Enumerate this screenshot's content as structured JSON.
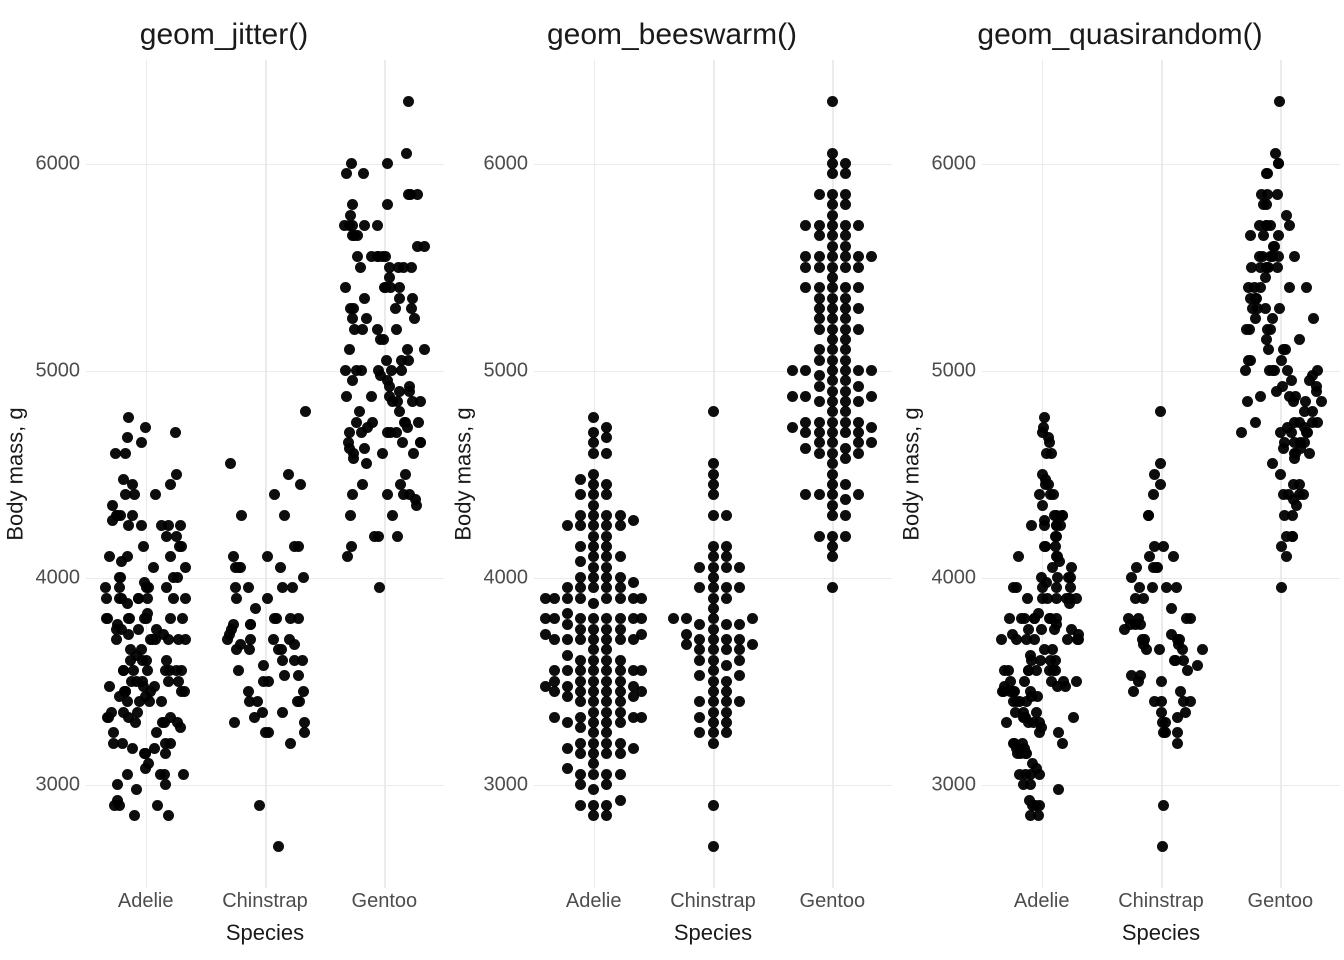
{
  "chart_data": [
    {
      "type": "scatter",
      "title": "geom_jitter()",
      "xlabel": "Species",
      "ylabel": "Body mass, g",
      "categories": [
        "Adelie",
        "Chinstrap",
        "Gentoo"
      ],
      "ylim": [
        2500,
        6500
      ],
      "yticks": [
        3000,
        4000,
        5000,
        6000
      ],
      "layout": "jitter",
      "range_estimates": {
        "Adelie": [
          2850,
          4775
        ],
        "Chinstrap": [
          2700,
          4800
        ],
        "Gentoo": [
          3950,
          6300
        ]
      }
    },
    {
      "type": "scatter",
      "title": "geom_beeswarm()",
      "xlabel": "Species",
      "ylabel": "Body mass, g",
      "categories": [
        "Adelie",
        "Chinstrap",
        "Gentoo"
      ],
      "ylim": [
        2500,
        6500
      ],
      "yticks": [
        3000,
        4000,
        5000,
        6000
      ],
      "layout": "beeswarm",
      "range_estimates": {
        "Adelie": [
          2850,
          4775
        ],
        "Chinstrap": [
          2700,
          4800
        ],
        "Gentoo": [
          3950,
          6300
        ]
      }
    },
    {
      "type": "scatter",
      "title": "geom_quasirandom()",
      "xlabel": "Species",
      "ylabel": "Body mass, g",
      "categories": [
        "Adelie",
        "Chinstrap",
        "Gentoo"
      ],
      "ylim": [
        2500,
        6500
      ],
      "yticks": [
        3000,
        4000,
        5000,
        6000
      ],
      "layout": "quasirandom",
      "range_estimates": {
        "Adelie": [
          2850,
          4775
        ],
        "Chinstrap": [
          2700,
          4800
        ],
        "Gentoo": [
          3950,
          6300
        ]
      }
    }
  ],
  "penguin_body_mass": {
    "Adelie": [
      3750,
      3800,
      3250,
      3450,
      3650,
      3625,
      4675,
      3475,
      4250,
      3300,
      3700,
      3200,
      3800,
      4400,
      3700,
      3450,
      4500,
      3325,
      4200,
      3400,
      3600,
      3800,
      3950,
      3800,
      3800,
      3550,
      3200,
      3150,
      3950,
      3250,
      3900,
      3300,
      3900,
      3325,
      4150,
      3950,
      3550,
      3300,
      4650,
      3150,
      3900,
      3100,
      4400,
      3000,
      4600,
      3425,
      2975,
      3450,
      4150,
      3500,
      4300,
      3450,
      4050,
      2900,
      3700,
      3550,
      3800,
      2850,
      3750,
      3150,
      4400,
      3600,
      4050,
      2850,
      3950,
      3350,
      4100,
      3050,
      4450,
      3600,
      3900,
      3550,
      4150,
      3700,
      4250,
      3700,
      3900,
      3550,
      4000,
      3200,
      4700,
      3800,
      4200,
      3350,
      3550,
      3800,
      3500,
      3950,
      3600,
      3550,
      4300,
      3400,
      4450,
      3300,
      4300,
      3700,
      4350,
      2900,
      4100,
      3725,
      4725,
      3075,
      4250,
      2925,
      3550,
      3750,
      3900,
      3175,
      4775,
      3825,
      4600,
      3200,
      4275,
      3900,
      4075,
      2900,
      3775,
      3350,
      3325,
      3150,
      3500,
      3450,
      3875,
      3050,
      4000,
      3275,
      4300,
      3050,
      4000,
      3325,
      3500,
      3500,
      4475,
      3425,
      3900,
      3175,
      3975,
      3400,
      4250,
      3400,
      3475,
      3050,
      3725,
      3000,
      3650,
      4250,
      3475,
      3450,
      3750,
      3700,
      4000,
      4100
    ],
    "Chinstrap": [
      3500,
      3900,
      3650,
      3525,
      3725,
      3950,
      3250,
      3750,
      4150,
      3700,
      3800,
      3775,
      3700,
      4050,
      3575,
      4050,
      3300,
      3700,
      3450,
      4400,
      3600,
      3400,
      2900,
      3800,
      3300,
      4150,
      3400,
      3800,
      3700,
      4550,
      3200,
      4300,
      3350,
      4100,
      3600,
      3900,
      3850,
      4800,
      2700,
      4500,
      3950,
      3650,
      3550,
      3500,
      3675,
      4450,
      3400,
      4300,
      3250,
      3675,
      3325,
      3950,
      3600,
      4050,
      3350,
      3450,
      3250,
      4050,
      3800,
      3525,
      3950,
      3650,
      3650,
      4000,
      3400,
      3775,
      4100,
      3775
    ],
    "Gentoo": [
      4500,
      5700,
      4450,
      5700,
      5400,
      4550,
      4800,
      5200,
      4400,
      5150,
      4650,
      5550,
      4650,
      5850,
      4200,
      5850,
      4150,
      6300,
      4800,
      5350,
      5700,
      5000,
      4400,
      5050,
      5000,
      5100,
      4100,
      5650,
      4600,
      5550,
      5250,
      4700,
      5050,
      6050,
      5150,
      5400,
      4950,
      5250,
      4350,
      5350,
      3950,
      5700,
      4300,
      4750,
      5550,
      4900,
      4200,
      5400,
      5100,
      5300,
      4850,
      5300,
      4400,
      5000,
      4900,
      5050,
      4300,
      5000,
      4450,
      5550,
      4200,
      5300,
      4400,
      5650,
      4700,
      5700,
      4650,
      5800,
      4700,
      5550,
      4750,
      5000,
      5100,
      5200,
      4700,
      5800,
      4600,
      6000,
      4750,
      5950,
      4625,
      5450,
      4725,
      5350,
      4750,
      5600,
      4600,
      5300,
      4875,
      5550,
      4950,
      5400,
      4750,
      5650,
      4850,
      5200,
      4925,
      4875,
      4625,
      5250,
      4850,
      5600,
      4975,
      5500,
      4725,
      5500,
      4700,
      5500,
      4575,
      5500,
      5000,
      5950,
      4650,
      5500,
      4375,
      5850,
      4875,
      6000,
      4925,
      4850,
      5750,
      5200,
      5400
    ]
  },
  "colors": {
    "point": "#000000",
    "grid": "#ebebeb",
    "text_major": "#1a1a1a",
    "text_minor": "#4d4d4d"
  }
}
